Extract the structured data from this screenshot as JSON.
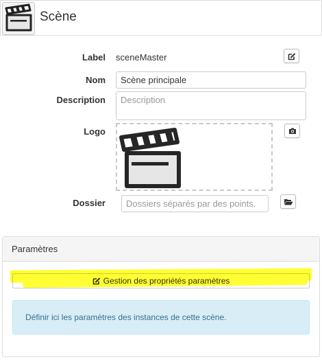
{
  "header": {
    "title": "Scène",
    "icon": "clapperboard-icon"
  },
  "form": {
    "label": {
      "label": "Label",
      "value": "sceneMaster",
      "button_icon": "edit-icon"
    },
    "nom": {
      "label": "Nom",
      "value": "Scène principale"
    },
    "description": {
      "label": "Description",
      "placeholder": "Description"
    },
    "logo": {
      "label": "Logo",
      "button_icon": "camera-icon",
      "image_icon": "clapperboard-icon"
    },
    "dossier": {
      "label": "Dossier",
      "placeholder": "Dossiers séparés par des points.",
      "button_icon": "folder-open-icon"
    }
  },
  "panel": {
    "title": "Paramètres",
    "manage_button": {
      "label": "Gestion des propriétés paramètres",
      "icon": "edit-icon"
    },
    "info_text": "Définir ici les paramètres des instances de cette scène.",
    "colors": {
      "highlight": "#ffff33",
      "info_bg": "#d9edf7",
      "info_text": "#31708f"
    }
  }
}
